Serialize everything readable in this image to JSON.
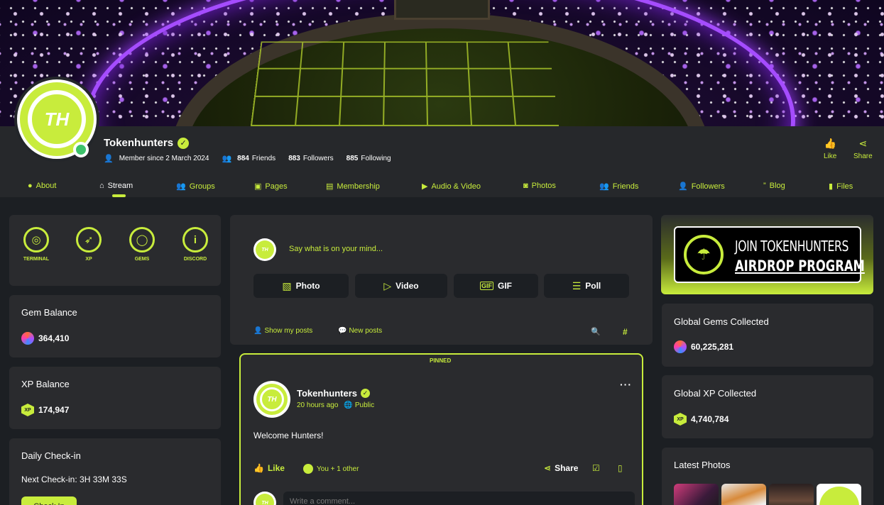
{
  "profile": {
    "name": "Tokenhunters",
    "avatar_initials": "TH",
    "member_since": "Member since 2 March 2024",
    "friends_count": "884",
    "friends_label": "Friends",
    "followers_count": "883",
    "followers_label": "Followers",
    "following_count": "885",
    "following_label": "Following",
    "like_label": "Like",
    "share_label": "Share"
  },
  "tabs": [
    {
      "label": "About",
      "icon": "user-circle-icon"
    },
    {
      "label": "Stream",
      "icon": "home-icon",
      "active": true
    },
    {
      "label": "Groups",
      "icon": "users-icon"
    },
    {
      "label": "Pages",
      "icon": "flag-icon"
    },
    {
      "label": "Membership",
      "icon": "id-card-icon"
    },
    {
      "label": "Audio & Video",
      "icon": "play-icon"
    },
    {
      "label": "Photos",
      "icon": "camera-icon"
    },
    {
      "label": "Friends",
      "icon": "user-friends-icon"
    },
    {
      "label": "Followers",
      "icon": "user-check-icon"
    },
    {
      "label": "Blog",
      "icon": "quote-icon"
    },
    {
      "label": "Files",
      "icon": "file-icon"
    }
  ],
  "shortcuts": [
    {
      "label": "TERMINAL",
      "icon": "target-icon"
    },
    {
      "label": "XP",
      "icon": "rocket-icon"
    },
    {
      "label": "GEMS",
      "icon": "ring-icon"
    },
    {
      "label": "DISCORD",
      "icon": "info-icon"
    }
  ],
  "gem_balance": {
    "title": "Gem Balance",
    "value": "364,410"
  },
  "xp_balance": {
    "title": "XP Balance",
    "value": "174,947",
    "badge": "XP"
  },
  "checkin": {
    "title": "Daily Check-in",
    "next": "Next Check-in: 3H 33M 33S",
    "button": "Check In"
  },
  "composer": {
    "placeholder": "Say what is on your mind...",
    "buttons": [
      "Photo",
      "Video",
      "GIF",
      "Poll"
    ]
  },
  "filters": {
    "show_my_posts": "Show my posts",
    "new_posts": "New posts"
  },
  "post": {
    "pinned_label": "PINNED",
    "author": "Tokenhunters",
    "time": "20 hours ago",
    "visibility": "Public",
    "body": "Welcome Hunters!",
    "like_label": "Like",
    "reactions": "You + 1 other",
    "share_label": "Share",
    "comment_placeholder": "Write a comment..."
  },
  "right": {
    "airdrop_line1": "JOIN TOKENHUNTERS",
    "airdrop_line2": "AIRDROP PROGRAM",
    "global_gems": {
      "title": "Global Gems Collected",
      "value": "60,225,281"
    },
    "global_xp": {
      "title": "Global XP Collected",
      "value": "4,740,784",
      "badge": "XP"
    },
    "latest_photos_title": "Latest Photos"
  },
  "colors": {
    "accent": "#c8ec3c",
    "background": "#1c1f23",
    "card": "#2a2b2e",
    "online": "#3cc26a"
  }
}
